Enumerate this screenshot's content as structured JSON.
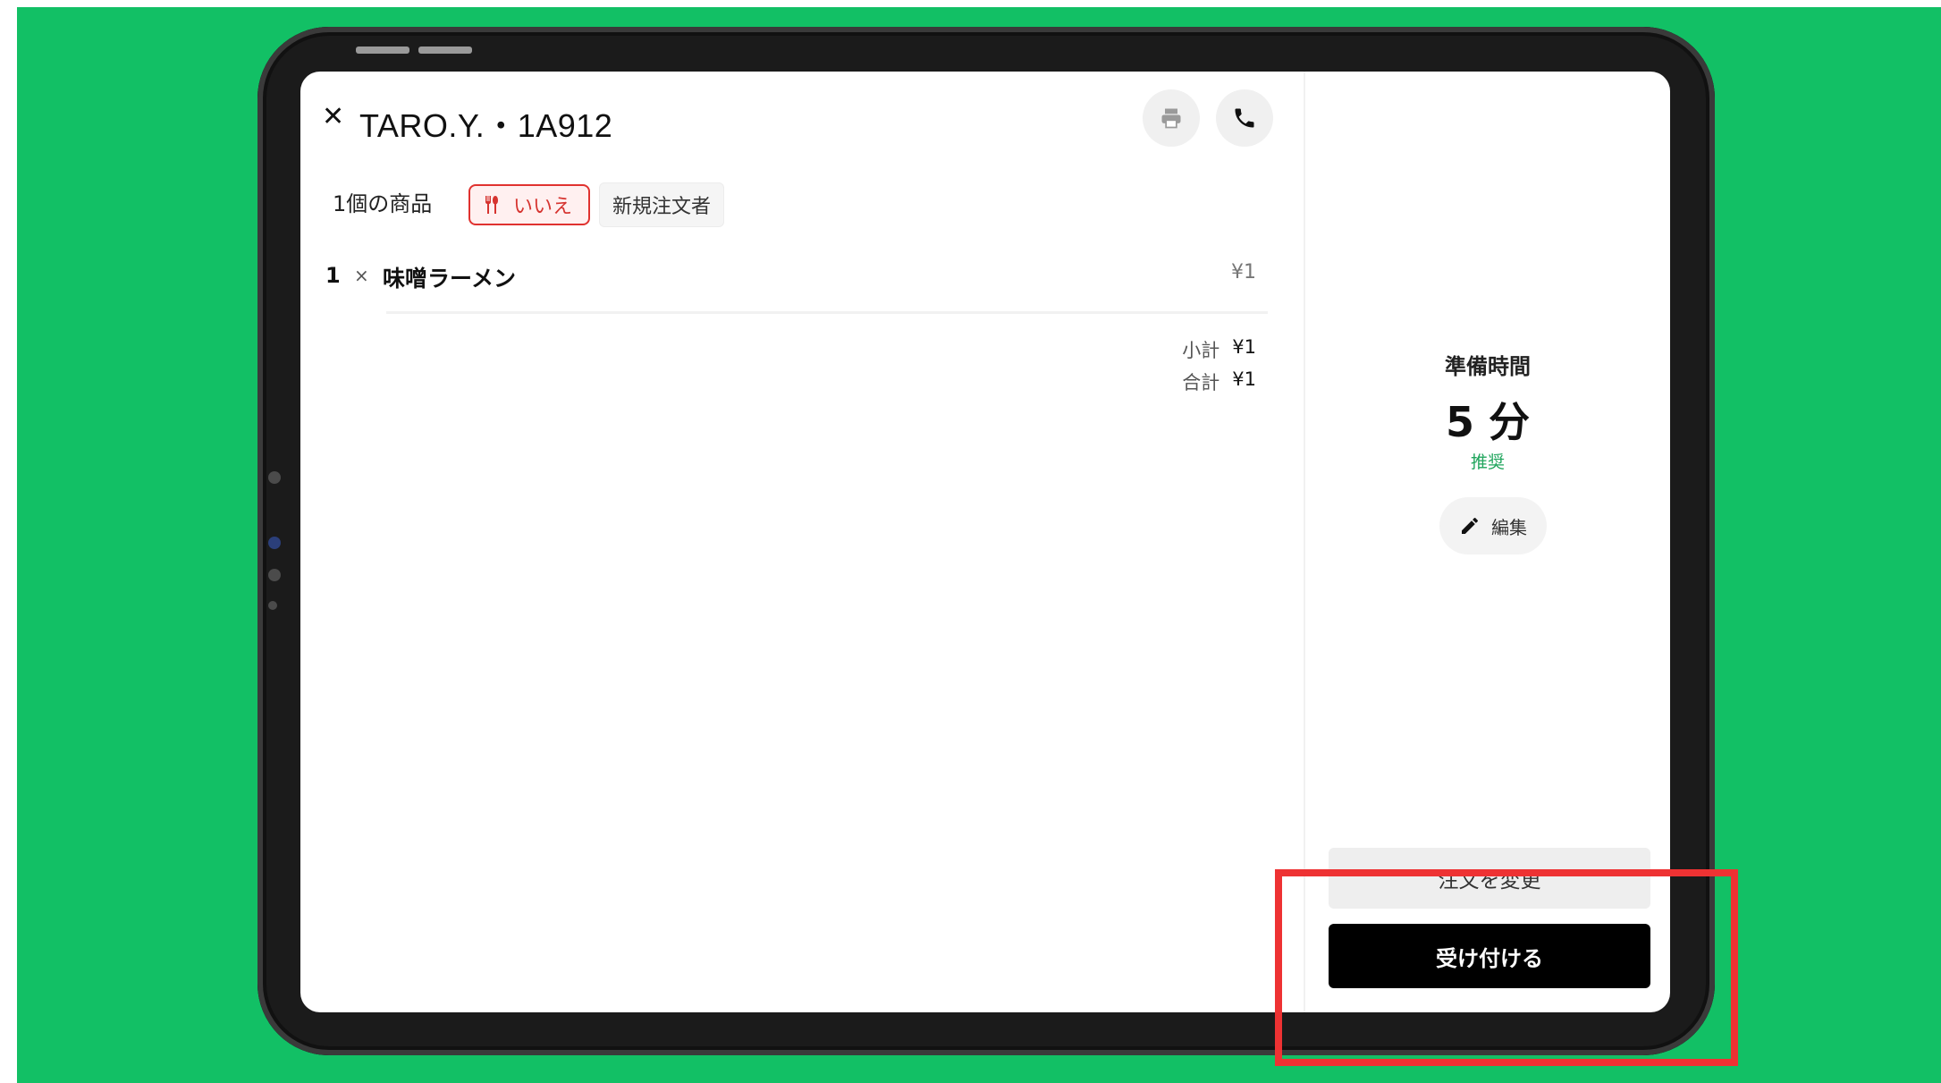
{
  "order": {
    "title": "TARO.Y.・1A912",
    "item_count_label": "1個の商品",
    "utensils_badge": "いいえ",
    "customer_badge": "新規注文者",
    "items": [
      {
        "qty": "1",
        "times": "×",
        "name": "味噌ラーメン",
        "price": "¥1"
      }
    ],
    "subtotal_label": "小計",
    "subtotal_value": "¥1",
    "total_label": "合計",
    "total_value": "¥1"
  },
  "icons": {
    "close": "close-icon",
    "print": "printer-icon",
    "phone": "phone-icon",
    "utensils": "utensils-icon",
    "edit": "pencil-icon"
  },
  "prep": {
    "label": "準備時間",
    "value": "5 分",
    "recommend": "推奨",
    "edit_label": "編集"
  },
  "actions": {
    "change_order": "注文を変更",
    "accept": "受け付ける"
  },
  "colors": {
    "background": "#12c065",
    "highlight": "#ee3233",
    "badge_red": "#d63430",
    "recommend_green": "#1fa55c",
    "accept_button": "#000000"
  }
}
